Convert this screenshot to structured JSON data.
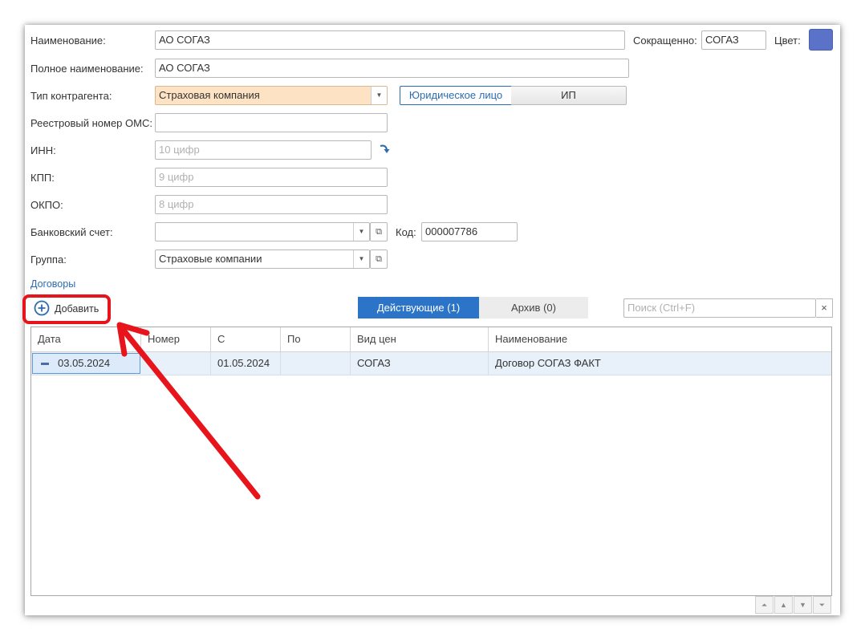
{
  "form": {
    "name_label": "Наименование:",
    "name_value": "АО СОГАЗ",
    "short_label": "Сокращенно:",
    "short_value": "СОГАЗ",
    "color_label": "Цвет:",
    "color_value": "#5b72c9",
    "fullname_label": "Полное наименование:",
    "fullname_value": "АО СОГАЗ",
    "type_label": "Тип контрагента:",
    "type_value": "Страховая компания",
    "legal_options": [
      "Юридическое лицо",
      "ИП"
    ],
    "oms_label": "Реестровый номер ОМС:",
    "oms_value": "",
    "inn_label": "ИНН:",
    "inn_placeholder": "10 цифр",
    "kpp_label": "КПП:",
    "kpp_placeholder": "9 цифр",
    "okpo_label": "ОКПО:",
    "okpo_placeholder": "8 цифр",
    "bank_label": "Банковский счет:",
    "bank_value": "",
    "code_label": "Код:",
    "code_value": "000007786",
    "group_label": "Группа:",
    "group_value": "Страховые компании"
  },
  "contracts": {
    "section_link": "Договоры",
    "add_button": "Добавить",
    "tabs": [
      "Действующие (1)",
      "Архив (0)"
    ],
    "search_placeholder": "Поиск (Ctrl+F)",
    "clear_icon": "×",
    "columns": [
      "Дата",
      "Номер",
      "С",
      "По",
      "Вид цен",
      "Наименование"
    ],
    "rows": [
      {
        "date": "03.05.2024",
        "number": "",
        "from": "01.05.2024",
        "to": "",
        "price_type": "СОГАЗ",
        "name": "Договор СОГАЗ ФАКТ"
      }
    ]
  },
  "colors": {
    "accent": "#2b6cb0",
    "active_tab": "#2b74c7",
    "annotation_red": "#e8141c",
    "type_field_bg": "#fde3c4"
  }
}
